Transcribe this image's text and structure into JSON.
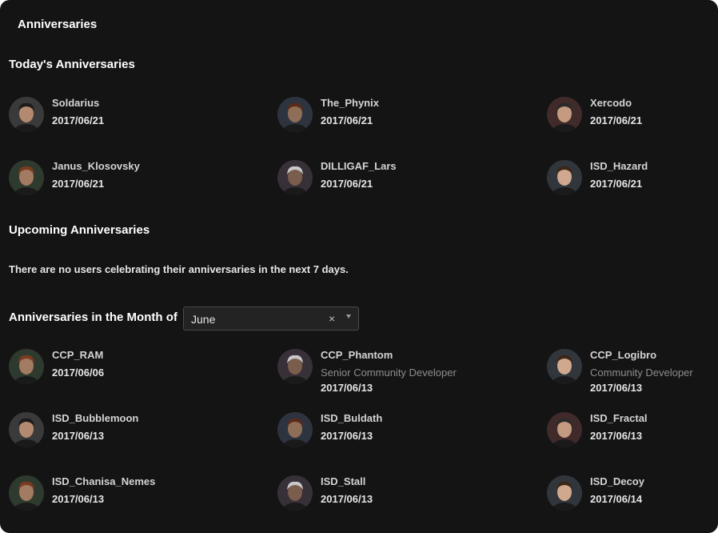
{
  "panel_title": "Anniversaries",
  "today": {
    "heading": "Today's Anniversaries",
    "users": [
      {
        "name": "Soldarius",
        "date": "2017/06/21"
      },
      {
        "name": "The_Phynix",
        "date": "2017/06/21"
      },
      {
        "name": "Xercodo",
        "date": "2017/06/21"
      },
      {
        "name": "Janus_Klosovsky",
        "date": "2017/06/21"
      },
      {
        "name": "DILLIGAF_Lars",
        "date": "2017/06/21"
      },
      {
        "name": "ISD_Hazard",
        "date": "2017/06/21"
      }
    ]
  },
  "upcoming": {
    "heading": "Upcoming Anniversaries",
    "empty_message": "There are no users celebrating their anniversaries in the next 7 days."
  },
  "month": {
    "label": "Anniversaries in the Month of",
    "selected": "June",
    "clear_symbol": "×",
    "users": [
      {
        "name": "CCP_RAM",
        "title": "",
        "date": "2017/06/06"
      },
      {
        "name": "CCP_Phantom",
        "title": "Senior Community Developer",
        "date": "2017/06/13"
      },
      {
        "name": "CCP_Logibro",
        "title": "Community Developer",
        "date": "2017/06/13"
      },
      {
        "name": "ISD_Bubblemoon",
        "title": "",
        "date": "2017/06/13"
      },
      {
        "name": "ISD_Buldath",
        "title": "",
        "date": "2017/06/13"
      },
      {
        "name": "ISD_Fractal",
        "title": "",
        "date": "2017/06/13"
      },
      {
        "name": "ISD_Chanisa_Nemes",
        "title": "",
        "date": "2017/06/13"
      },
      {
        "name": "ISD_Stall",
        "title": "",
        "date": "2017/06/13"
      },
      {
        "name": "ISD_Decoy",
        "title": "",
        "date": "2017/06/14"
      }
    ]
  },
  "icons": {
    "avatar": "user-avatar-icon",
    "clear": "clear-icon",
    "caret": "chevron-down-icon"
  },
  "colors": {
    "background": "#141414",
    "heading": "#ffffff",
    "username": "#d4d4d4",
    "subtitle": "#8d8d8d",
    "select_bg": "#232323"
  }
}
